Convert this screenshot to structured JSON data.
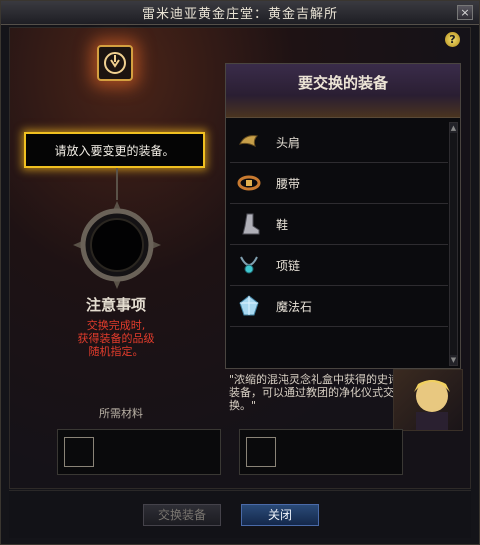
{
  "window": {
    "title": "雷米迪亚黄金庄堂：黄金吉解所",
    "close_glyph": "×"
  },
  "help": {
    "glyph": "?"
  },
  "tooltip": {
    "text": "请放入要变更的装备。"
  },
  "notice": {
    "title": "注意事项",
    "lines": [
      "交换完成时,",
      "获得装备的品级",
      "随机指定。"
    ]
  },
  "panel": {
    "header": "要交换的装备",
    "items": [
      {
        "label": "头肩",
        "icon": "shoulder-armor-icon"
      },
      {
        "label": "腰带",
        "icon": "belt-icon"
      },
      {
        "label": "鞋",
        "icon": "boots-icon"
      },
      {
        "label": "项链",
        "icon": "necklace-icon"
      },
      {
        "label": "魔法石",
        "icon": "magic-stone-icon"
      }
    ]
  },
  "quote": {
    "text": "\"浓缩的混沌灵念礼盒中获得的史诗装备，可以通过教团的净化仪式交换。\""
  },
  "materials": {
    "label": "所需材料"
  },
  "buttons": {
    "exchange": "交换装备",
    "close": "关闭"
  },
  "colors": {
    "accent_gold": "#f0c020",
    "warning_red": "#e23c2c",
    "close_button": "#2a4a78"
  }
}
